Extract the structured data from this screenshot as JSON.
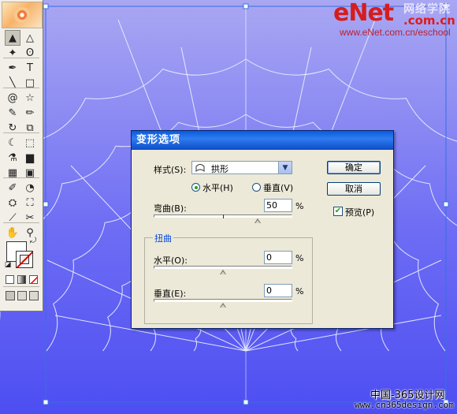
{
  "watermark": {
    "brand": "eNet",
    "brand_cn": "网络学院",
    "domain": ".com.cn",
    "url": "www.eNet.com.cn/eschool",
    "bottom_cn": "中国-365设计网",
    "bottom_url": "www.cn365design.com"
  },
  "colors": {
    "canvas_top": "#a9a7f2",
    "canvas_bottom": "#4d4ef2",
    "titlebar": "#0a5bdc",
    "accent_label": "#0046d5",
    "watermark_red": "#d61d1d"
  },
  "toolbox": {
    "tools": [
      {
        "name": "selection-tool",
        "icon": "arrow-icon",
        "glyph": "▲"
      },
      {
        "name": "direct-selection-tool",
        "icon": "hollow-arrow-icon",
        "glyph": "△"
      },
      {
        "name": "magic-wand-tool",
        "icon": "wand-icon",
        "glyph": "✦"
      },
      {
        "name": "lasso-tool",
        "icon": "lasso-icon",
        "glyph": "ʘ"
      },
      {
        "name": "pen-tool",
        "icon": "pen-icon",
        "glyph": "✒"
      },
      {
        "name": "type-tool",
        "icon": "type-icon",
        "glyph": "T"
      },
      {
        "name": "line-tool",
        "icon": "line-icon",
        "glyph": "╲"
      },
      {
        "name": "rectangle-tool",
        "icon": "rectangle-icon",
        "glyph": "□"
      },
      {
        "name": "spiral-tool",
        "icon": "spiral-icon",
        "glyph": "@"
      },
      {
        "name": "star-tool",
        "icon": "star-icon",
        "glyph": "☆"
      },
      {
        "name": "paintbrush-tool",
        "icon": "paintbrush-icon",
        "glyph": "✎"
      },
      {
        "name": "pencil-tool",
        "icon": "pencil-icon",
        "glyph": "✏"
      },
      {
        "name": "rotate-tool",
        "icon": "rotate-icon",
        "glyph": "↻"
      },
      {
        "name": "scale-tool",
        "icon": "scale-icon",
        "glyph": "⧉"
      },
      {
        "name": "warp-tool",
        "icon": "warp-icon",
        "glyph": "☾"
      },
      {
        "name": "free-transform-tool",
        "icon": "free-transform-icon",
        "glyph": "⬚"
      },
      {
        "name": "symbol-sprayer-tool",
        "icon": "sprayer-icon",
        "glyph": "⚗"
      },
      {
        "name": "graph-tool",
        "icon": "graph-icon",
        "glyph": "▆"
      },
      {
        "name": "mesh-tool",
        "icon": "mesh-icon",
        "glyph": "▦"
      },
      {
        "name": "gradient-tool",
        "icon": "gradient-icon",
        "glyph": "▣"
      },
      {
        "name": "eyedropper-tool",
        "icon": "eyedropper-icon",
        "glyph": "✐"
      },
      {
        "name": "blend-tool",
        "icon": "blend-icon",
        "glyph": "◔"
      },
      {
        "name": "live-paint-tool",
        "icon": "live-paint-icon",
        "glyph": "⛭"
      },
      {
        "name": "live-paint-selection-tool",
        "icon": "live-paint-selection-icon",
        "glyph": "⛶"
      },
      {
        "name": "slice-tool",
        "icon": "slice-icon",
        "glyph": "⟋"
      },
      {
        "name": "scissors-tool",
        "icon": "scissors-icon",
        "glyph": "✂"
      },
      {
        "name": "hand-tool",
        "icon": "hand-icon",
        "glyph": "✋"
      },
      {
        "name": "zoom-tool",
        "icon": "zoom-icon",
        "glyph": "⚲"
      }
    ]
  },
  "dialog": {
    "title": "变形选项",
    "style_label": "样式(S):",
    "style_value": "拱形",
    "ok_label": "确定",
    "cancel_label": "取消",
    "preview_label": "预览(P)",
    "preview_checked": true,
    "orientation_horizontal": "水平(H)",
    "orientation_vertical": "垂直(V)",
    "orientation_selected": "horizontal",
    "bend_label": "弯曲(B):",
    "bend_value": "50",
    "percent": "%",
    "distortion_group": "扭曲",
    "horizontal_label": "水平(O):",
    "horizontal_value": "0",
    "vertical_label": "垂直(E):",
    "vertical_value": "0"
  }
}
